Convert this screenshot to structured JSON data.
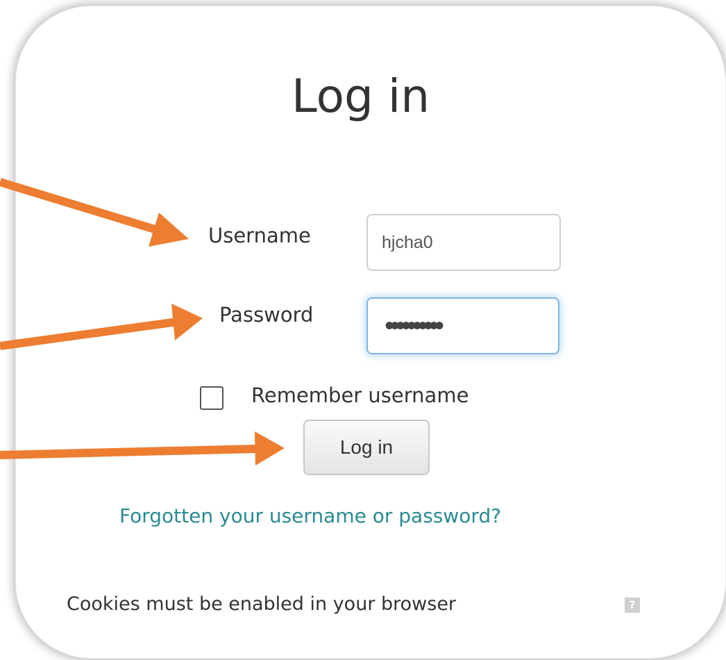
{
  "page": {
    "title": "Log in"
  },
  "form": {
    "username_label": "Username",
    "username_value": "hjcha0",
    "password_label": "Password",
    "password_value": "••••••••••",
    "remember_label": "Remember username",
    "remember_checked": false,
    "submit_label": "Log in",
    "forgot_link": "Forgotten your username or password?",
    "cookies_note": "Cookies must be enabled in your browser",
    "help_glyph": "?"
  },
  "annotations": {
    "arrow_color": "#ED7D31",
    "arrow_targets": [
      "username-field",
      "password-field",
      "login-button"
    ]
  },
  "colors": {
    "link": "#2a8a91",
    "focus_border": "#7fb3e6"
  }
}
